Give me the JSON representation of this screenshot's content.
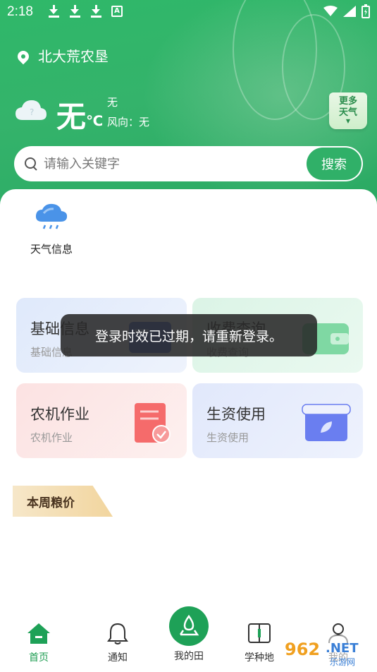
{
  "status_bar": {
    "time": "2:18"
  },
  "header": {
    "location": "北大荒农垦",
    "weather": {
      "temp": "无",
      "unit": "℃",
      "desc": "无",
      "wind": "风向：无"
    },
    "more_weather": [
      "更多",
      "天气"
    ]
  },
  "search": {
    "placeholder": "请输入关键字",
    "button": "搜索"
  },
  "quick_entry": {
    "weather_info": "天气信息"
  },
  "cards": {
    "basic": {
      "title": "基础信息",
      "sub": "基础信息"
    },
    "fee": {
      "title": "收费查询",
      "sub": "收费查询"
    },
    "farm": {
      "title": "农机作业",
      "sub": "农机作业"
    },
    "supply": {
      "title": "生资使用",
      "sub": "生资使用"
    }
  },
  "section": {
    "grain_price": "本周粮价"
  },
  "toast": "登录时效已过期，请重新登录。",
  "nav": {
    "home": "首页",
    "notice": "通知",
    "field": "我的田",
    "learn": "学种地",
    "mine": "我的"
  },
  "watermark": "962.NET 乐游网",
  "colors": {
    "brand_green": "#30b068",
    "active_nav": "#1e9d52",
    "grain_tag": "#f2d59e"
  }
}
